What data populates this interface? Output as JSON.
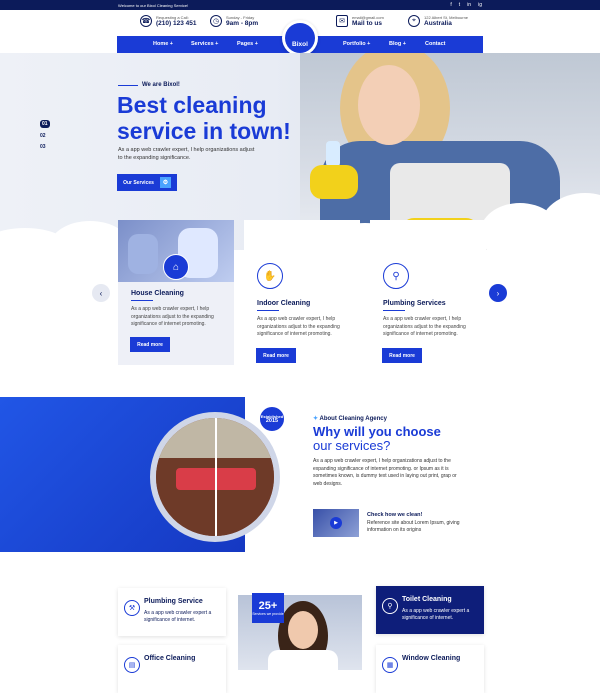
{
  "topbar": {
    "welcome": "Welcome to our Bixol Cleaning Service!",
    "social": [
      "f",
      "t",
      "in",
      "ig"
    ]
  },
  "info": {
    "call_label": "Requesting a Call:",
    "call_value": "(210) 123 451",
    "hours_label": "Sunday - Friday",
    "hours_value": "9am - 8pm",
    "mail_label": "email@gmail.com",
    "mail_value": "Mail to us",
    "addr_label": "122 Albert St, Melbourne",
    "addr_value": "Australia"
  },
  "nav": {
    "items": [
      "Home +",
      "Services +",
      "Pages +",
      "Portfolio +",
      "Blog +",
      "Contact"
    ],
    "logo": "Bixol"
  },
  "hero": {
    "eyebrow": "We are Bixol!",
    "title": "Best cleaning service in town!",
    "lead": "As a app web crawler expert, I help organizations adjust to the expanding significance.",
    "button": "Our Services",
    "slides": [
      "01",
      "02",
      "03"
    ]
  },
  "services": [
    {
      "title": "House Cleaning",
      "desc": "As a app web crawler expert, I help organizations adjust to the expanding significance of internet promoting.",
      "button": "Read more"
    },
    {
      "title": "Indoor Cleaning",
      "desc": "As a app web crawler expert, I help organizations adjust to the expanding significance of internet promoting.",
      "button": "Read more"
    },
    {
      "title": "Plumbing Services",
      "desc": "As a app web crawler expert, I help organizations adjust to the expanding significance of internet promoting.",
      "button": "Read more"
    }
  ],
  "why": {
    "badge_line1": "Established",
    "badge_year": "2015",
    "eyebrow": "About Cleaning Agency",
    "title_bold": "Why will you choose",
    "title_light": "our services?",
    "para": "As a app web crawler expert, I help organizations adjust to the expanding significance of internet promoting. or Ipsum as it is sometimes known, is dummy text used in laying out print, grap or web designs.",
    "video_title": "Check how we clean!",
    "video_desc": "Reference site about Lorem Ipsum, giving information on its origins"
  },
  "lower": {
    "badge_num": "25+",
    "badge_text": "Services we provide",
    "cards": [
      {
        "title": "Plumbing Service",
        "desc": "As a app web crawler expert a significance of internet."
      },
      {
        "title": "Toilet Cleaning",
        "desc": "As a app web crawler expert a significance of internet."
      },
      {
        "title": "Office Cleaning",
        "desc": ""
      },
      {
        "title": "Window Cleaning",
        "desc": ""
      }
    ]
  },
  "colors": {
    "primary": "#1a3bd6",
    "dark": "#0c1b5a",
    "accent": "#f2d11b"
  }
}
